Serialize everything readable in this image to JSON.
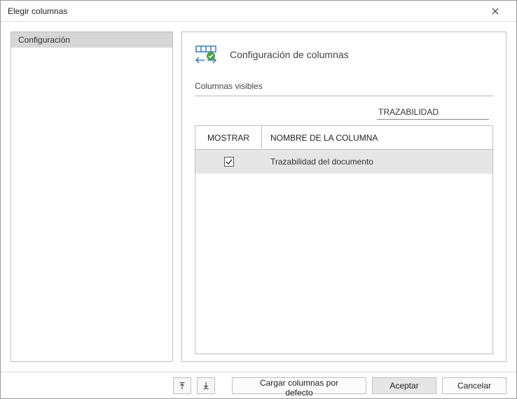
{
  "dialog": {
    "title": "Elegir columnas"
  },
  "sidebar": {
    "items": [
      {
        "label": "Configuración"
      }
    ]
  },
  "panel": {
    "title": "Configuración de columnas",
    "section_label": "Columnas visibles",
    "search_value": "TRAZABILIDAD",
    "columns": {
      "show": "MOSTRAR",
      "name": "NOMBRE DE LA COLUMNA"
    },
    "rows": [
      {
        "checked": true,
        "name": "Trazabilidad del documento"
      }
    ]
  },
  "footer": {
    "load_defaults": "Cargar columnas por defecto",
    "accept": "Aceptar",
    "cancel": "Cancelar"
  }
}
